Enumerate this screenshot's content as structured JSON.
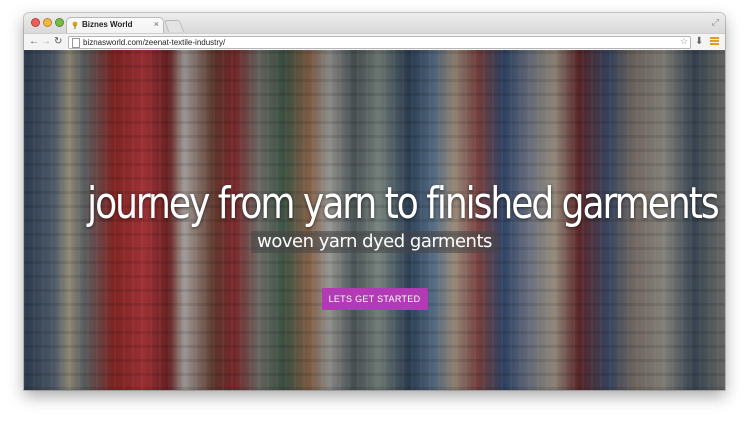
{
  "browser": {
    "tab_title": "Biznes World",
    "tab_close": "×",
    "url": "biznasworld.com/zeenat-textile-industry/",
    "icons": {
      "back": "back-arrow-icon",
      "forward": "forward-arrow-icon",
      "reload": "reload-icon",
      "star": "star-icon",
      "extension": "extension-icon",
      "menu": "hamburger-menu-icon",
      "fullscreen": "fullscreen-icon"
    },
    "glyphs": {
      "back": "←",
      "forward": "→",
      "reload": "↻",
      "star": "☆",
      "extension": "⬇",
      "fullscreen": "⤢"
    },
    "colors": {
      "close": "#ee5d57",
      "minimize": "#f1b83f",
      "zoom": "#73bd47",
      "menu_accent": "#e39b28"
    }
  },
  "hero": {
    "headline": "journey from yarn to finished garments",
    "subheadline": "woven yarn dyed garments",
    "cta_label": "LETS GET STARTED",
    "cta_color": "#b23ab5"
  }
}
